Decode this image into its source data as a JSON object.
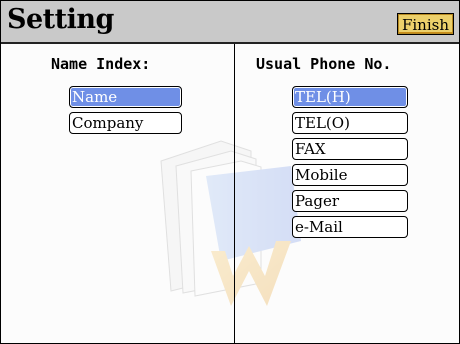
{
  "title": "Setting",
  "finish_label": "Finish",
  "name_index": {
    "header": "Name Index:",
    "options": [
      {
        "label": "Name",
        "selected": true
      },
      {
        "label": "Company",
        "selected": false
      }
    ]
  },
  "usual_phone": {
    "header": "Usual Phone No.",
    "options": [
      {
        "label": "TEL(H)",
        "selected": true
      },
      {
        "label": "TEL(O)",
        "selected": false
      },
      {
        "label": "FAX",
        "selected": false
      },
      {
        "label": "Mobile",
        "selected": false
      },
      {
        "label": "Pager",
        "selected": false
      },
      {
        "label": "e-Mail",
        "selected": false
      }
    ]
  },
  "colors": {
    "titlebar": "#c9c9c9",
    "selected": "#6f8fe6",
    "finish_button": "#ecd06b"
  },
  "icons": [
    "folder-watermark-icon"
  ]
}
